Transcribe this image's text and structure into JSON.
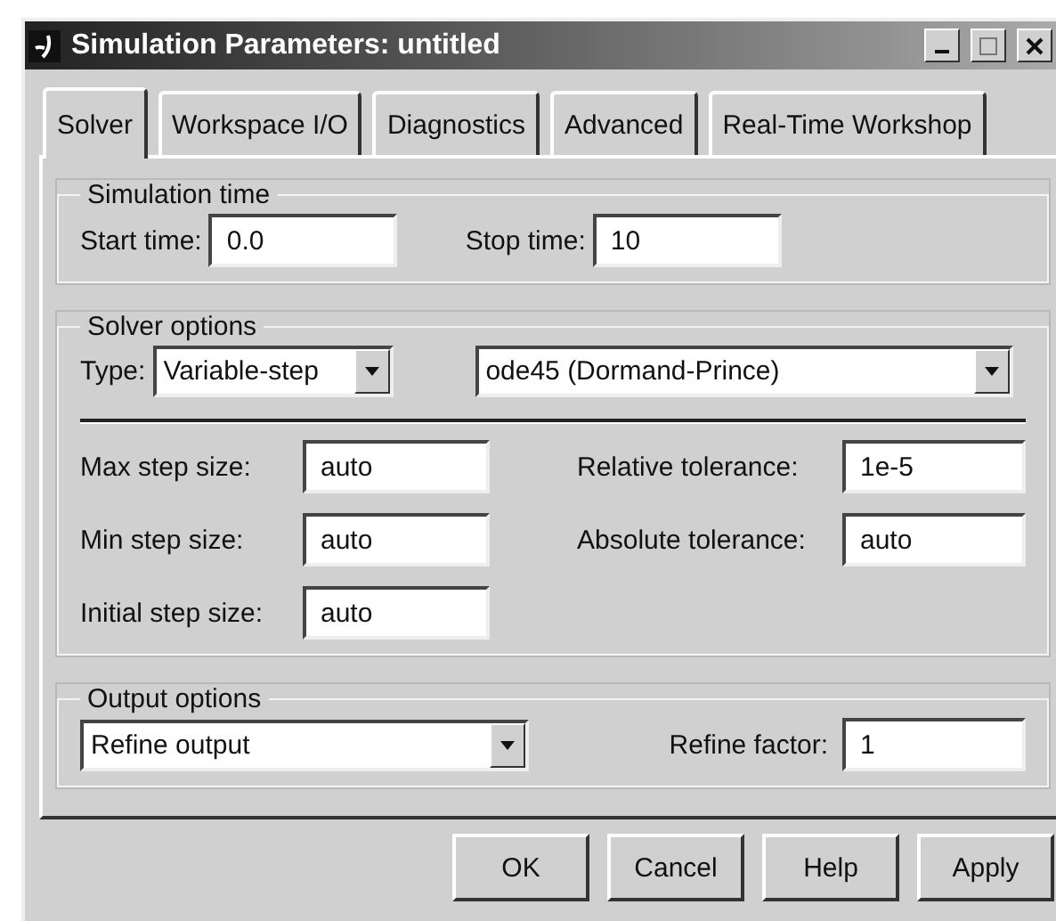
{
  "window": {
    "title": "Simulation Parameters: untitled"
  },
  "tabs": [
    {
      "label": "Solver",
      "selected": true
    },
    {
      "label": "Workspace I/O",
      "selected": false
    },
    {
      "label": "Diagnostics",
      "selected": false
    },
    {
      "label": "Advanced",
      "selected": false
    },
    {
      "label": "Real-Time Workshop",
      "selected": false
    }
  ],
  "simulation_time": {
    "label": "Simulation time",
    "fields": [
      {
        "label": "Start time:",
        "value": "0.0"
      },
      {
        "label": "Stop time:",
        "value": "10"
      }
    ]
  },
  "solver_options": {
    "label": "Solver options",
    "type_label": "Type:",
    "type_value": "Variable-step",
    "solver_value": "ode45 (Dormand-Prince)",
    "left_fields": [
      {
        "label": "Max step size:",
        "value": "auto"
      },
      {
        "label": "Min step size:",
        "value": "auto"
      },
      {
        "label": "Initial step size:",
        "value": "auto"
      }
    ],
    "right_fields": [
      {
        "label": "Relative tolerance:",
        "value": "1e-5"
      },
      {
        "label": "Absolute tolerance:",
        "value": "auto"
      }
    ]
  },
  "output_options": {
    "label": "Output options",
    "output_value": "Refine output",
    "fields": [
      {
        "label": "Refine factor:",
        "value": "1"
      }
    ]
  },
  "buttons": [
    "OK",
    "Cancel",
    "Help",
    "Apply"
  ]
}
